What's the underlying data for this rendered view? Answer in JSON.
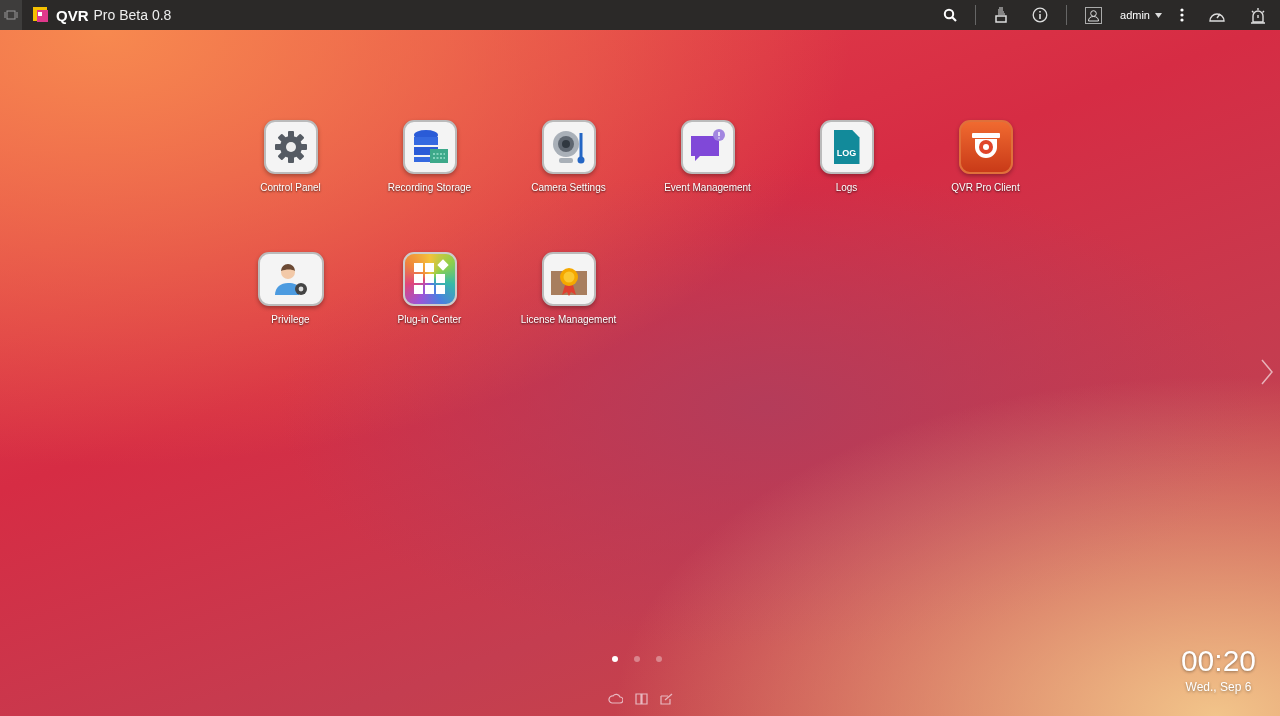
{
  "topbar": {
    "brand": "QVR",
    "title": "Pro Beta 0.8",
    "user": "admin"
  },
  "apps": [
    {
      "label": "Control Panel",
      "kind": "gear"
    },
    {
      "label": "Recording Storage",
      "kind": "storage"
    },
    {
      "label": "Camera Settings",
      "kind": "camera"
    },
    {
      "label": "Event Management",
      "kind": "event"
    },
    {
      "label": "Logs",
      "kind": "log",
      "badge": "LOG"
    },
    {
      "label": "QVR Pro Client",
      "kind": "client"
    },
    {
      "label": "Privilege",
      "kind": "user"
    },
    {
      "label": "Plug-in Center",
      "kind": "plugin"
    },
    {
      "label": "License Management",
      "kind": "license"
    }
  ],
  "pages": [
    {
      "selected": true
    },
    {
      "selected": false
    },
    {
      "selected": false
    }
  ],
  "clock": {
    "time": "00:20",
    "date": "Wed., Sep 6"
  }
}
